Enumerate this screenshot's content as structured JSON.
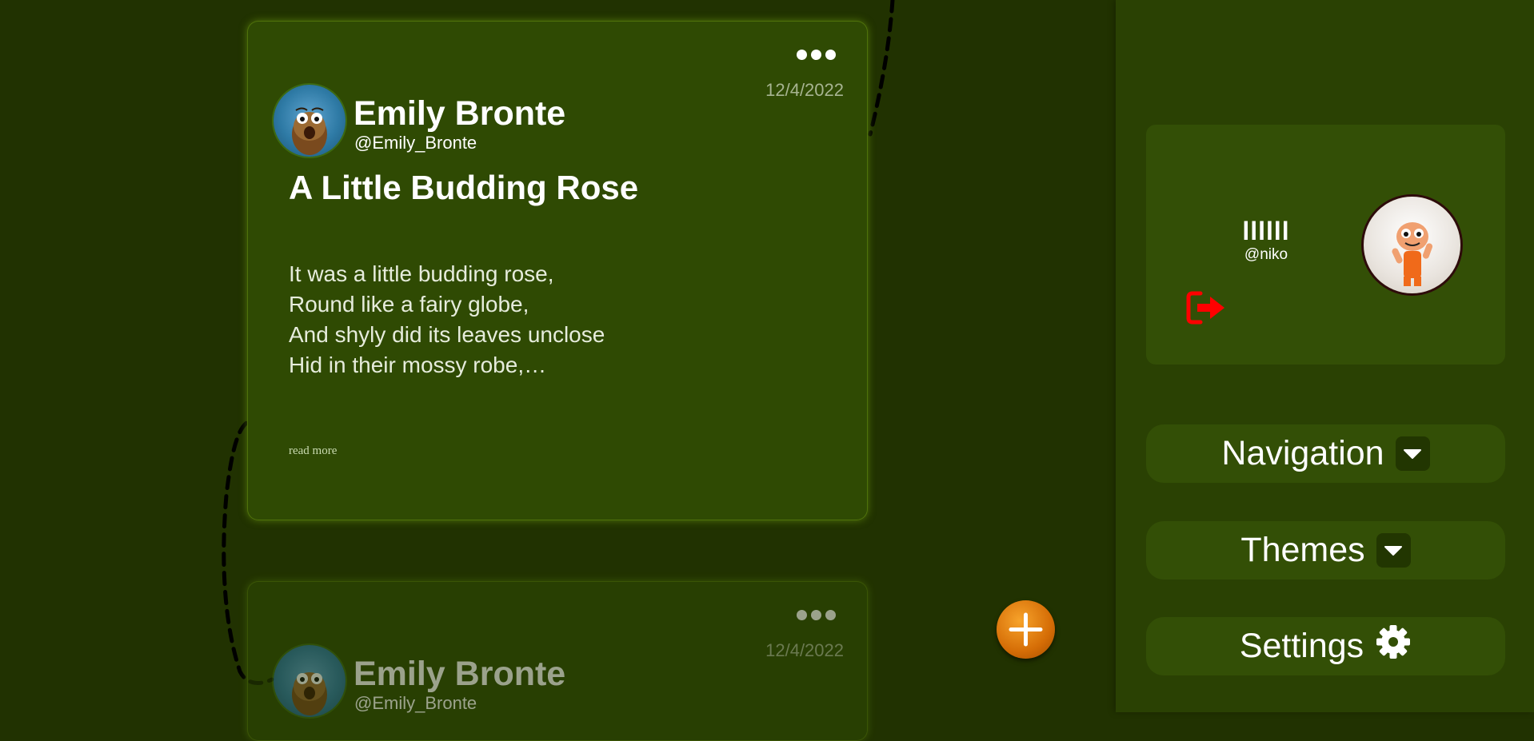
{
  "posts": [
    {
      "author_name": "Emily Bronte",
      "author_handle": "@Emily_Bronte",
      "date": "12/4/2022",
      "title": "A Little Budding Rose",
      "excerpt_lines": [
        "It was a little budding rose,",
        "Round like a fairy globe,",
        "And shyly did its leaves unclose",
        "Hid in their mossy robe,…"
      ],
      "read_more": "read more"
    },
    {
      "author_name": "Emily Bronte",
      "author_handle": "@Emily_Bronte",
      "date": "12/4/2022"
    }
  ],
  "profile": {
    "display_name": "llllll",
    "handle": "@niko"
  },
  "nav": {
    "navigation_label": "Navigation",
    "themes_label": "Themes",
    "settings_label": "Settings"
  },
  "colors": {
    "background": "#213201",
    "card": "#2f4a03",
    "sidebar": "#2a4103",
    "accent_orange": "#d56d06",
    "logout_red": "#ff0000"
  },
  "icons": [
    "more-options-icon",
    "add-icon",
    "logout-icon",
    "chevron-down-icon",
    "gear-icon"
  ]
}
